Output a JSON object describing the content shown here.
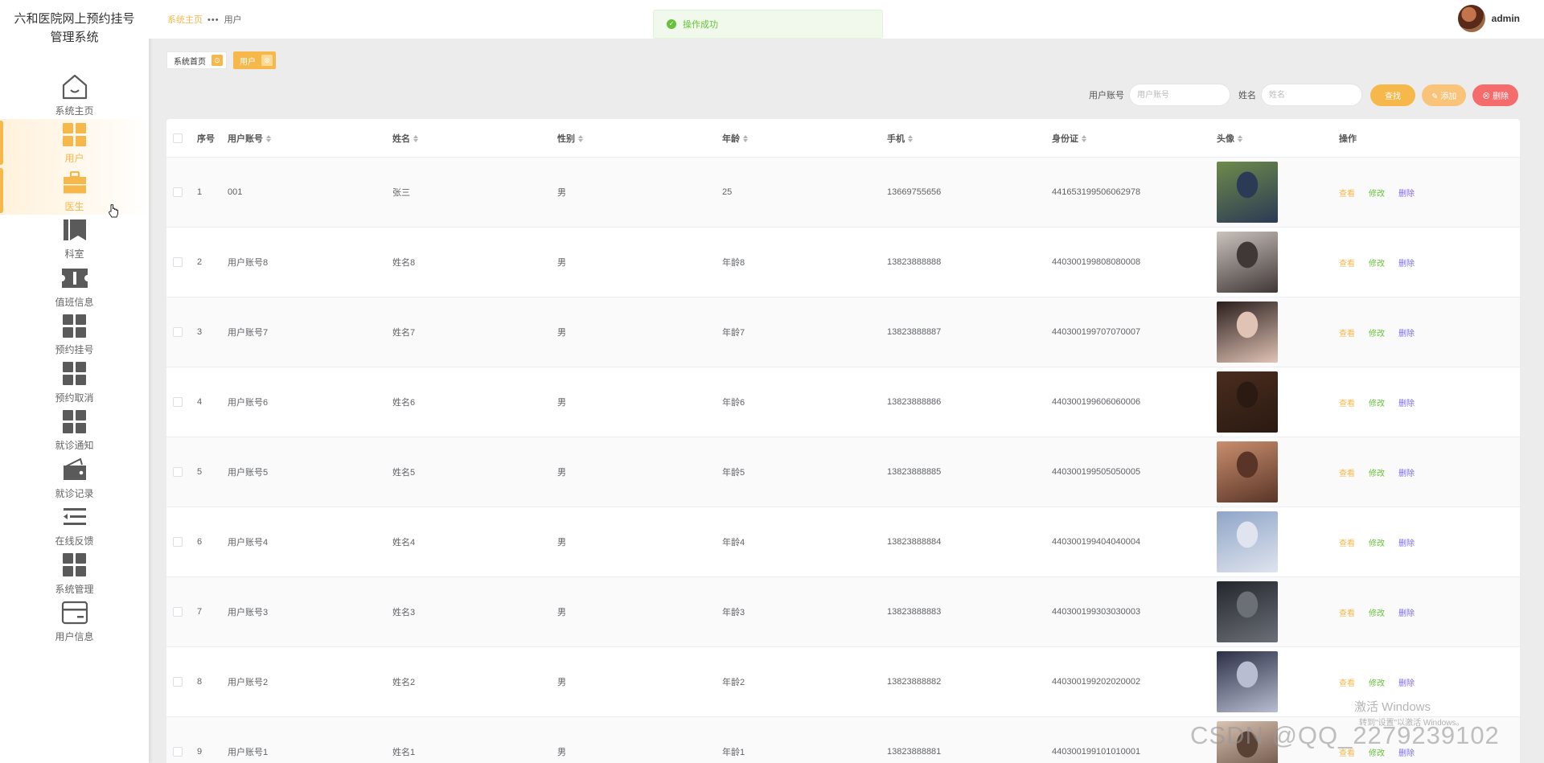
{
  "app": {
    "title": "六和医院网上预约挂号管理系统"
  },
  "sidebar": {
    "items": [
      {
        "label": "系统主页",
        "icon": "home-icon",
        "active": false
      },
      {
        "label": "用户",
        "icon": "grid-icon",
        "active": true
      },
      {
        "label": "医生",
        "icon": "briefcase-icon",
        "active": true
      },
      {
        "label": "科室",
        "icon": "bookmark-icon",
        "active": false
      },
      {
        "label": "值班信息",
        "icon": "ticket-icon",
        "active": false
      },
      {
        "label": "预约挂号",
        "icon": "grid-icon",
        "active": false
      },
      {
        "label": "预约取消",
        "icon": "grid-icon",
        "active": false
      },
      {
        "label": "就诊通知",
        "icon": "grid-icon",
        "active": false
      },
      {
        "label": "就诊记录",
        "icon": "wallet-icon",
        "active": false
      },
      {
        "label": "在线反馈",
        "icon": "list-icon",
        "active": false
      },
      {
        "label": "系统管理",
        "icon": "grid-icon",
        "active": false
      },
      {
        "label": "用户信息",
        "icon": "card-icon",
        "active": false
      }
    ]
  },
  "header": {
    "breadcrumb": {
      "home": "系统主页",
      "separator": "•••",
      "current": "用户"
    },
    "user_name": "admin",
    "toast": "操作成功"
  },
  "tags": [
    {
      "label": "系统首页",
      "close": "⊙"
    },
    {
      "label": "用户",
      "close": "⊗"
    }
  ],
  "search": {
    "account_label": "用户账号",
    "account_placeholder": "用户账号",
    "name_label": "姓名",
    "name_placeholder": "姓名",
    "find_label": "查找",
    "add_label": "✎ 添加",
    "delete_label": "⊗ 删除"
  },
  "table": {
    "headers": [
      "序号",
      "用户账号",
      "姓名",
      "性别",
      "年龄",
      "手机",
      "身份证",
      "头像",
      "操作"
    ],
    "actions": {
      "view": "查看",
      "edit": "修改",
      "delete": "删除"
    },
    "rows": [
      {
        "index": "1",
        "account": "001",
        "name": "张三",
        "gender": "男",
        "age": "25",
        "phone": "13669755656",
        "id_card": "441653199506062978",
        "avatar_colors": [
          "#6e8a4a",
          "#2b3a55"
        ]
      },
      {
        "index": "2",
        "account": "用户账号8",
        "name": "姓名8",
        "gender": "男",
        "age": "年龄8",
        "phone": "13823888888",
        "id_card": "440300199808080008",
        "avatar_colors": [
          "#c9c2bd",
          "#403836"
        ]
      },
      {
        "index": "3",
        "account": "用户账号7",
        "name": "姓名7",
        "gender": "男",
        "age": "年龄7",
        "phone": "13823888887",
        "id_card": "440300199707070007",
        "avatar_colors": [
          "#2a1e1c",
          "#e0c3b5"
        ]
      },
      {
        "index": "4",
        "account": "用户账号6",
        "name": "姓名6",
        "gender": "男",
        "age": "年龄6",
        "phone": "13823888886",
        "id_card": "440300199606060006",
        "avatar_colors": [
          "#4a2c1e",
          "#2a1a12"
        ]
      },
      {
        "index": "5",
        "account": "用户账号5",
        "name": "姓名5",
        "gender": "男",
        "age": "年龄5",
        "phone": "13823888885",
        "id_card": "440300199505050005",
        "avatar_colors": [
          "#c98e6e",
          "#5a3527"
        ]
      },
      {
        "index": "6",
        "account": "用户账号4",
        "name": "姓名4",
        "gender": "男",
        "age": "年龄4",
        "phone": "13823888884",
        "id_card": "440300199404040004",
        "avatar_colors": [
          "#8fa5c8",
          "#dfe4ee"
        ]
      },
      {
        "index": "7",
        "account": "用户账号3",
        "name": "姓名3",
        "gender": "男",
        "age": "年龄3",
        "phone": "13823888883",
        "id_card": "440300199303030003",
        "avatar_colors": [
          "#23272d",
          "#6b6f76"
        ]
      },
      {
        "index": "8",
        "account": "用户账号2",
        "name": "姓名2",
        "gender": "男",
        "age": "年龄2",
        "phone": "13823888882",
        "id_card": "440300199202020002",
        "avatar_colors": [
          "#2c2f45",
          "#b8bdd2"
        ]
      },
      {
        "index": "9",
        "account": "用户账号1",
        "name": "姓名1",
        "gender": "男",
        "age": "年龄1",
        "phone": "13823888881",
        "id_card": "440300199101010001",
        "avatar_colors": [
          "#d8c2b0",
          "#5a4136"
        ]
      }
    ]
  },
  "watermark": {
    "activate_title": "激活 Windows",
    "activate_sub": "转到\"设置\"以激活 Windows。",
    "csdn": "CSDN @QQ_2279239102"
  },
  "theme": {
    "accent": "#f7b84b",
    "danger": "#f56c6c",
    "success": "#67c23a",
    "purple": "#7c6cf0"
  }
}
